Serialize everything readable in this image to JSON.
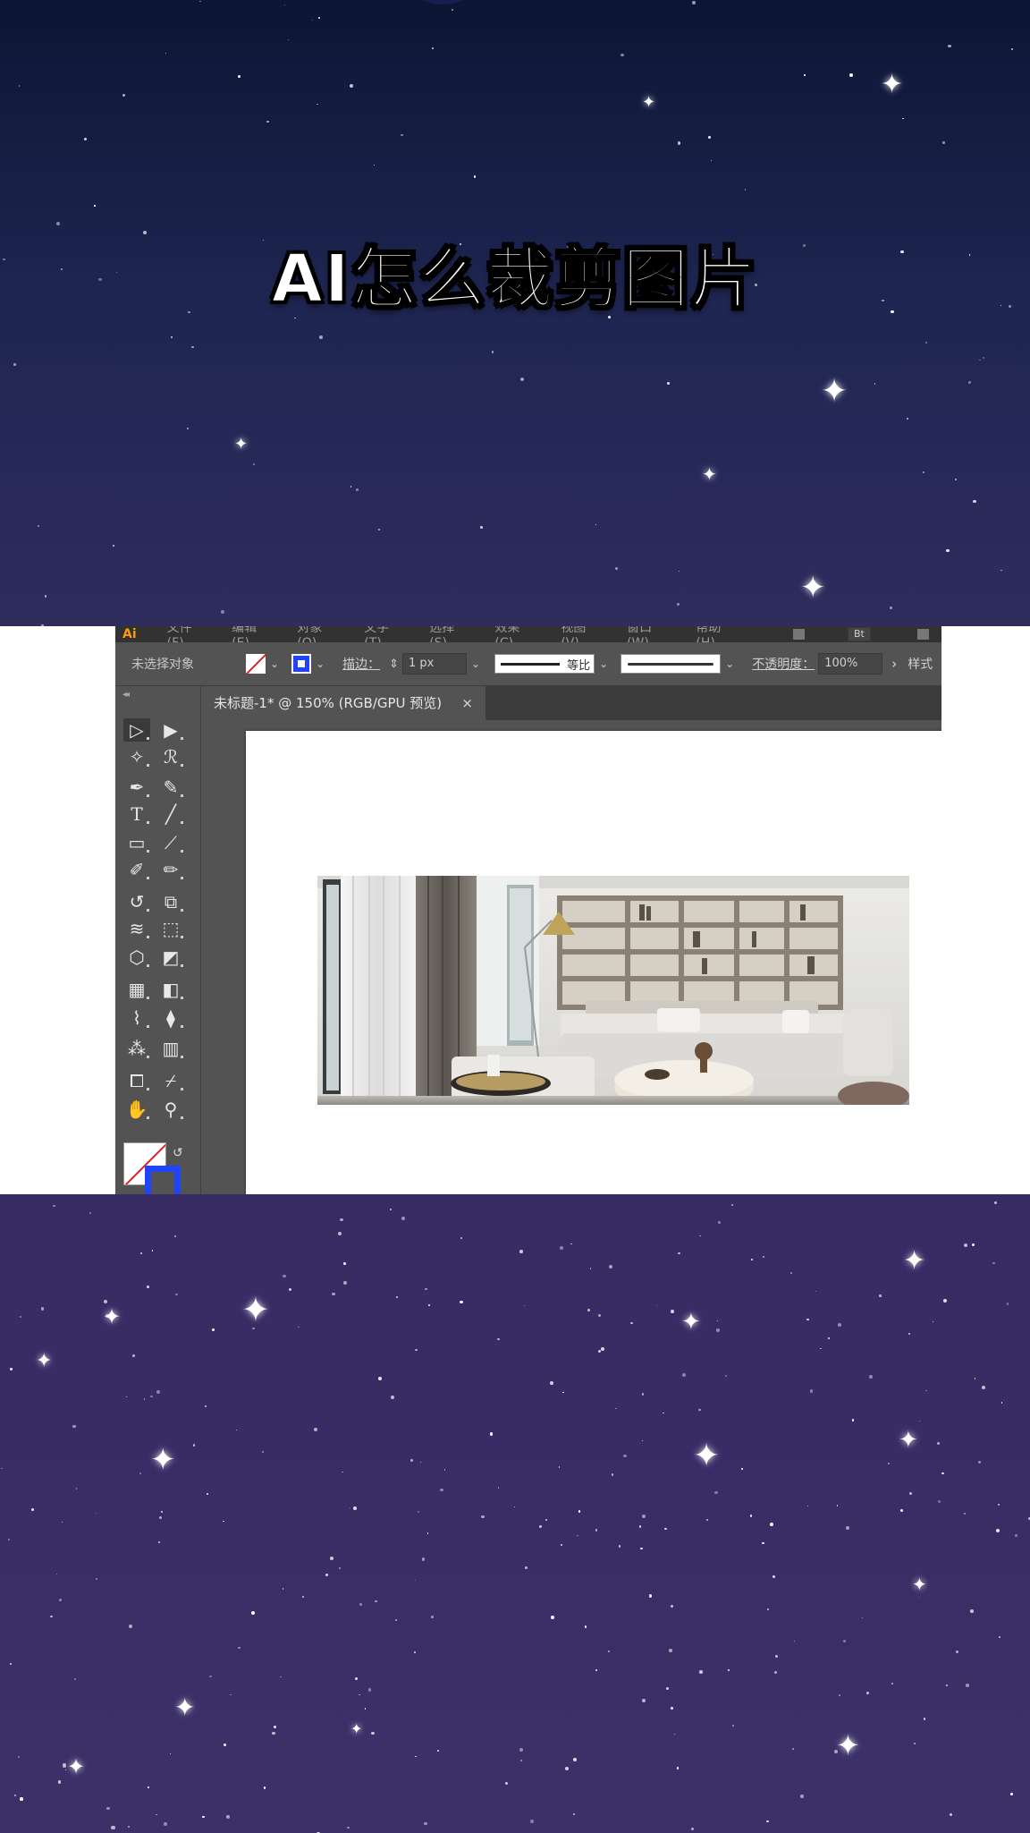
{
  "title": "AI怎么裁剪图片",
  "menubar": {
    "logo": "Ai",
    "items": [
      "文件(F)",
      "编辑(E)",
      "对象(O)",
      "文字(T)",
      "选择(S)",
      "效果(C)",
      "视图(V)",
      "窗口(W)",
      "帮助(H)"
    ],
    "workspace_label": "Bt"
  },
  "control_bar": {
    "no_selection": "未选择对象",
    "stroke_label": "描边：",
    "stroke_weight": "1 px",
    "stroke_profile": "等比",
    "opacity_label": "不透明度：",
    "opacity_value": "100%",
    "style_label": "样式"
  },
  "document_tab": {
    "label": "未标题-1* @ 150% (RGB/GPU 预览)",
    "close": "×"
  },
  "tools": [
    "selection",
    "direct-selection",
    "magic-wand",
    "lasso",
    "pen",
    "curvature",
    "type",
    "line",
    "rectangle",
    "paintbrush",
    "shaper",
    "pencil",
    "rotate",
    "scale",
    "warp",
    "free-transform",
    "shape-builder",
    "perspective",
    "mesh",
    "gradient",
    "eyedropper",
    "blend",
    "symbol-sprayer",
    "column-graph",
    "artboard",
    "slice",
    "hand",
    "zoom"
  ],
  "colors": {
    "accent_stroke": "#1e44ff",
    "none_slash": "#e02020",
    "ui_panel": "#535353"
  }
}
